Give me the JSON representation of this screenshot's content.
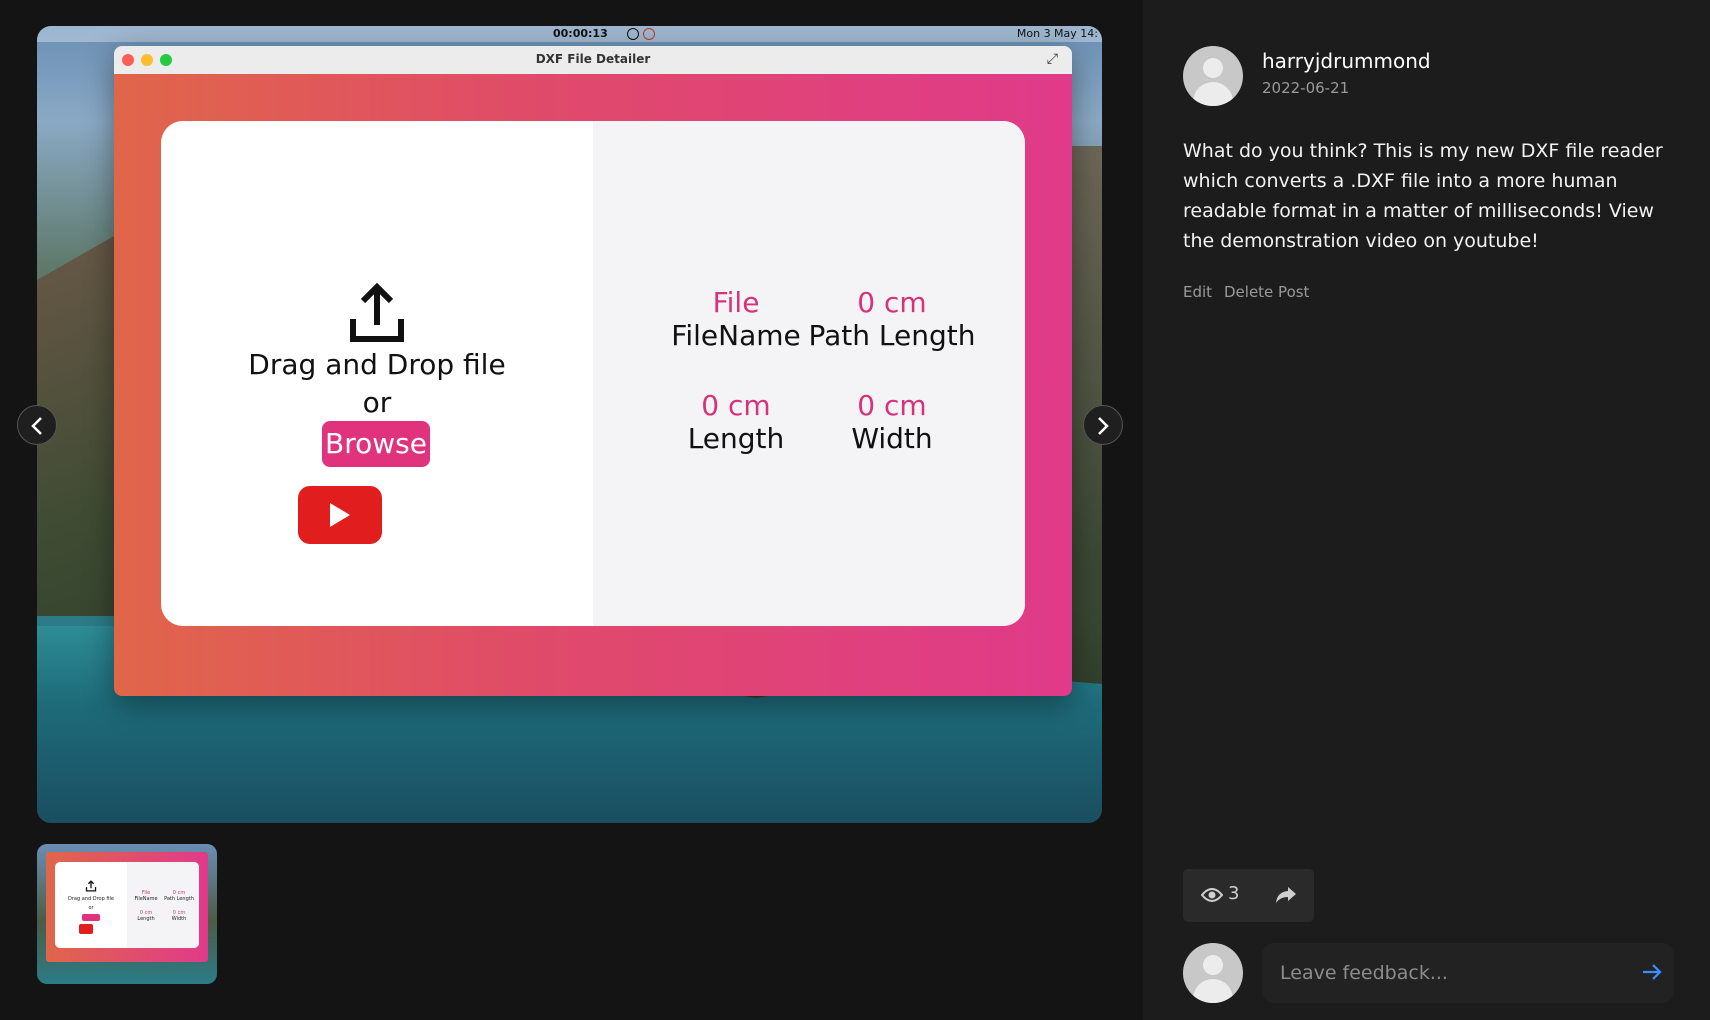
{
  "media": {
    "menubar": {
      "recording_time": "00:00:13",
      "clock": "Mon 3 May 14:"
    },
    "window_title": "DXF File Detailer",
    "upload": {
      "drag_text": "Drag and Drop file",
      "or_text": "or",
      "browse_label": "Browse"
    },
    "stats": [
      {
        "value": "File",
        "label": "FileName"
      },
      {
        "value": "0 cm",
        "label": "Path Length"
      },
      {
        "value": "0 cm",
        "label": "Length"
      },
      {
        "value": "0 cm",
        "label": "Width"
      }
    ]
  },
  "post": {
    "author": "harryjdrummond",
    "date": "2022-06-21",
    "body": "What do you think? This is my new DXF file reader which converts a .DXF file into a more human readable format in a matter of milliseconds! View the demonstration video on youtube!",
    "edit_label": "Edit",
    "delete_label": "Delete Post",
    "views": "3"
  },
  "feedback": {
    "placeholder": "Leave feedback..."
  },
  "colors": {
    "accent_pink": "#e0327d",
    "youtube_red": "#e11d1d",
    "send_blue": "#3a8cff",
    "panel_bg": "#1c1c1c"
  },
  "icons": [
    "chevron-left-icon",
    "chevron-right-icon",
    "upload-icon",
    "youtube-play-icon",
    "eye-icon",
    "share-icon",
    "send-arrow-icon",
    "user-avatar-icon"
  ]
}
